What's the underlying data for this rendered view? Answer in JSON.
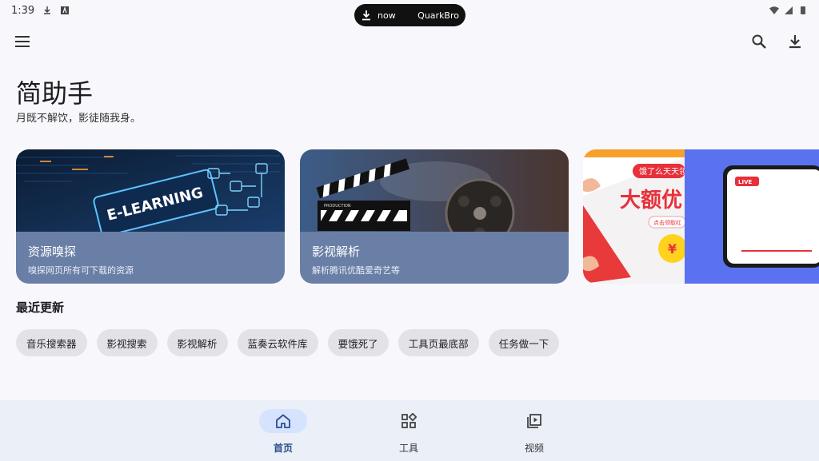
{
  "status_bar": {
    "time": "1:39"
  },
  "notification": {
    "status": "now",
    "app": "QuarkBro"
  },
  "header": {
    "title": "简助手",
    "subtitle": "月既不解饮，影徒随我身。"
  },
  "cards": [
    {
      "title": "资源嗅探",
      "subtitle": "嗅探网页所有可下载的资源",
      "image_text": "E-LEARNING"
    },
    {
      "title": "影视解析",
      "subtitle": "解析腾讯优酷爱奇艺等",
      "image_text": "PRODUCTION"
    },
    {
      "banner_top": "饿了么天天领",
      "banner_big": "大额优",
      "banner_small": "点击领取红",
      "coin": "¥",
      "live_badge": "LIVE"
    }
  ],
  "recent": {
    "title": "最近更新",
    "chips": [
      "音乐搜索器",
      "影视搜索",
      "影视解析",
      "蓝奏云软件库",
      "要饿死了",
      "工具页最底部",
      "任务做一下"
    ]
  },
  "bottom_nav": [
    {
      "label": "首页",
      "icon": "home-icon",
      "active": true
    },
    {
      "label": "工具",
      "icon": "widgets-icon",
      "active": false
    },
    {
      "label": "视频",
      "icon": "video-library-icon",
      "active": false
    }
  ],
  "colors": {
    "accent": "#2b4c8c",
    "card_band": "#6a7fa6",
    "nav_bg": "#eaeff8",
    "chip_bg": "#e3e2e8"
  }
}
